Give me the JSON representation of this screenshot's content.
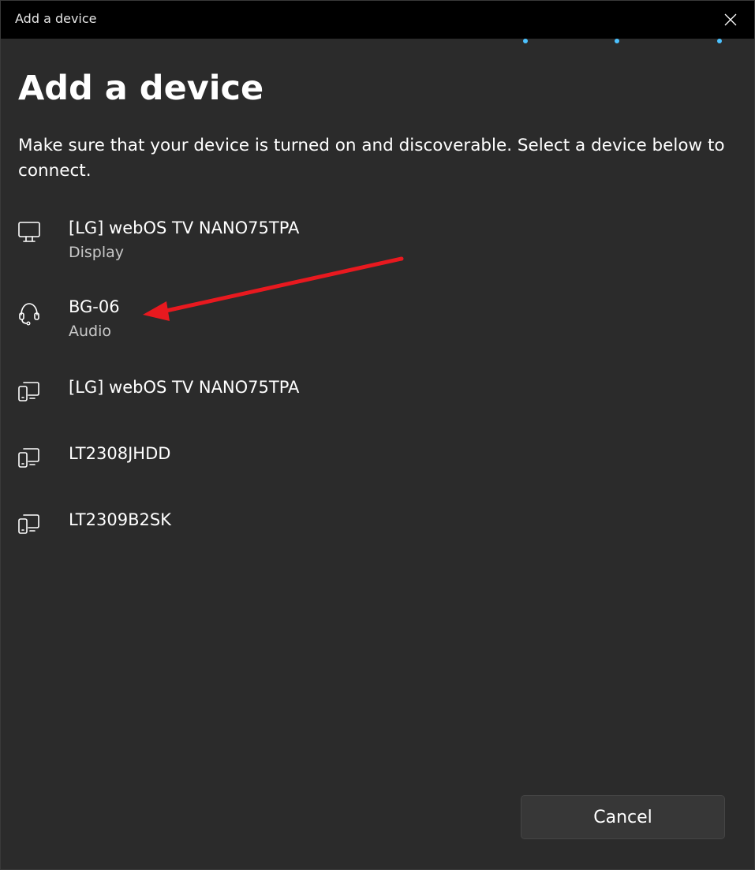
{
  "window": {
    "title": "Add a device"
  },
  "page": {
    "heading": "Add a device",
    "instructions": "Make sure that your device is turned on and discoverable. Select a device below to connect."
  },
  "devices": [
    {
      "name": "[LG] webOS TV NANO75TPA",
      "type": "Display",
      "icon": "monitor-icon"
    },
    {
      "name": "BG-06",
      "type": "Audio",
      "icon": "headset-icon"
    },
    {
      "name": "[LG] webOS TV NANO75TPA",
      "type": "",
      "icon": "phone-monitor-icon"
    },
    {
      "name": "LT2308JHDD",
      "type": "",
      "icon": "phone-monitor-icon"
    },
    {
      "name": "LT2309B2SK",
      "type": "",
      "icon": "phone-monitor-icon"
    }
  ],
  "footer": {
    "cancel_label": "Cancel"
  },
  "colors": {
    "background": "#2b2b2b",
    "titlebar": "#000000",
    "accent": "#4cc2ff",
    "annotation": "#e8191f"
  }
}
